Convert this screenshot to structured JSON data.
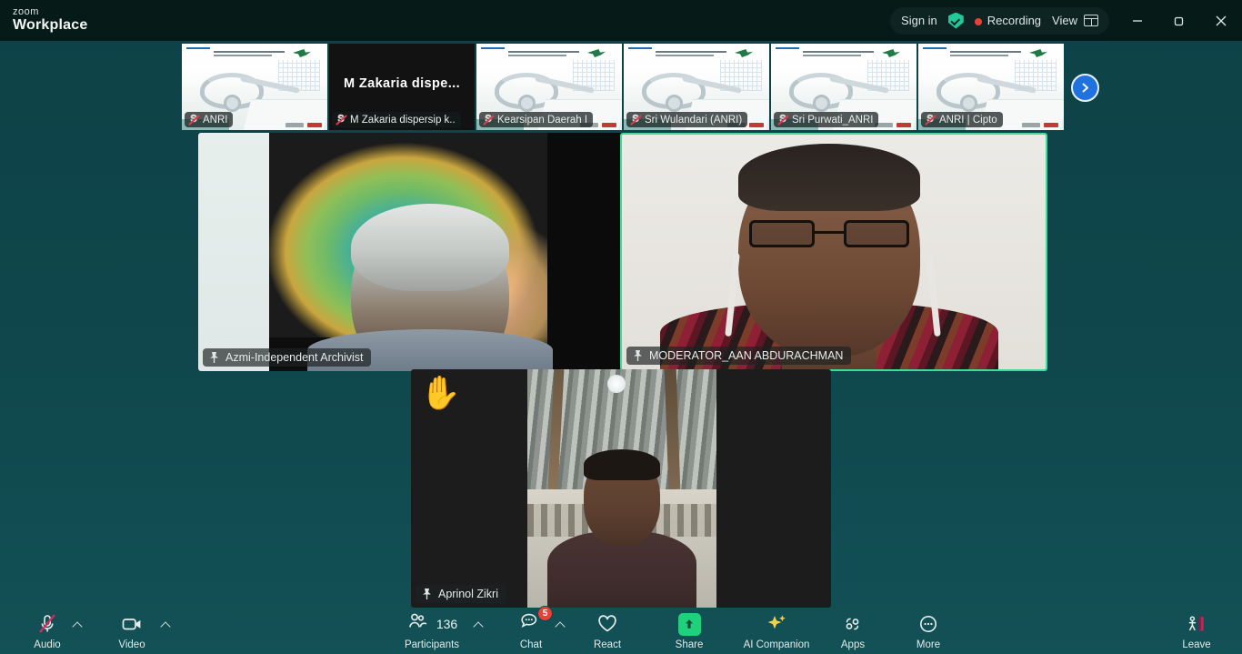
{
  "app": {
    "brand_top": "zoom",
    "brand_bottom": "Workplace",
    "background_color": "#0d4247",
    "titlebar_color": "#061a18"
  },
  "titlebar": {
    "sign_in": "Sign in",
    "encryption_icon": "shield-check-icon",
    "recording": "Recording",
    "recording_color": "#e8413a",
    "view": "View",
    "view_icon": "grid-layout-icon",
    "minimize": "–",
    "maximize": "❐",
    "close": "✕"
  },
  "filmstrip": {
    "next_icon": "chevron-right-icon",
    "thumbnails": [
      {
        "label": "ANRI",
        "muted": true,
        "type": "slide"
      },
      {
        "label": "M Zakaria dispersip k..",
        "muted": true,
        "type": "text",
        "big_text": "M Zakaria dispe..."
      },
      {
        "label": "Kearsipan Daerah I",
        "muted": true,
        "type": "slide"
      },
      {
        "label": "Sri Wulandari (ANRI)",
        "muted": true,
        "type": "slide"
      },
      {
        "label": "Sri Purwati_ANRI",
        "muted": true,
        "type": "slide"
      },
      {
        "label": "ANRI | Cipto",
        "muted": true,
        "type": "slide"
      }
    ]
  },
  "main_tiles": [
    {
      "name": "Azmi-Independent Archivist",
      "pinned": true,
      "active_speaker": false,
      "hand_raised": false
    },
    {
      "name": "MODERATOR_AAN ABDURACHMAN",
      "pinned": true,
      "active_speaker": true,
      "hand_raised": false,
      "border_color": "#3ddc97"
    },
    {
      "name": "Aprinol Zikri",
      "pinned": true,
      "active_speaker": false,
      "hand_raised": true,
      "hand_emoji": "✋"
    }
  ],
  "toolbar": {
    "audio": {
      "label": "Audio",
      "icon": "microphone-muted-icon",
      "muted": true,
      "has_chevron": true
    },
    "video": {
      "label": "Video",
      "icon": "camera-icon",
      "muted": false,
      "has_chevron": true
    },
    "participants": {
      "label": "Participants",
      "icon": "participants-icon",
      "count": "136",
      "has_chevron": true
    },
    "chat": {
      "label": "Chat",
      "icon": "chat-bubble-icon",
      "badge": "5",
      "has_chevron": true
    },
    "react": {
      "label": "React",
      "icon": "heart-icon"
    },
    "share": {
      "label": "Share",
      "icon": "share-screen-icon",
      "accent": "#21d07a"
    },
    "ai_companion": {
      "label": "AI Companion",
      "icon": "sparkle-icon",
      "accent": "#f0c killer"
    },
    "apps": {
      "label": "Apps",
      "icon": "apps-icon"
    },
    "more": {
      "label": "More",
      "icon": "more-dots-icon"
    },
    "leave": {
      "label": "Leave",
      "icon": "leave-door-icon",
      "accent": "#d6316a"
    }
  }
}
